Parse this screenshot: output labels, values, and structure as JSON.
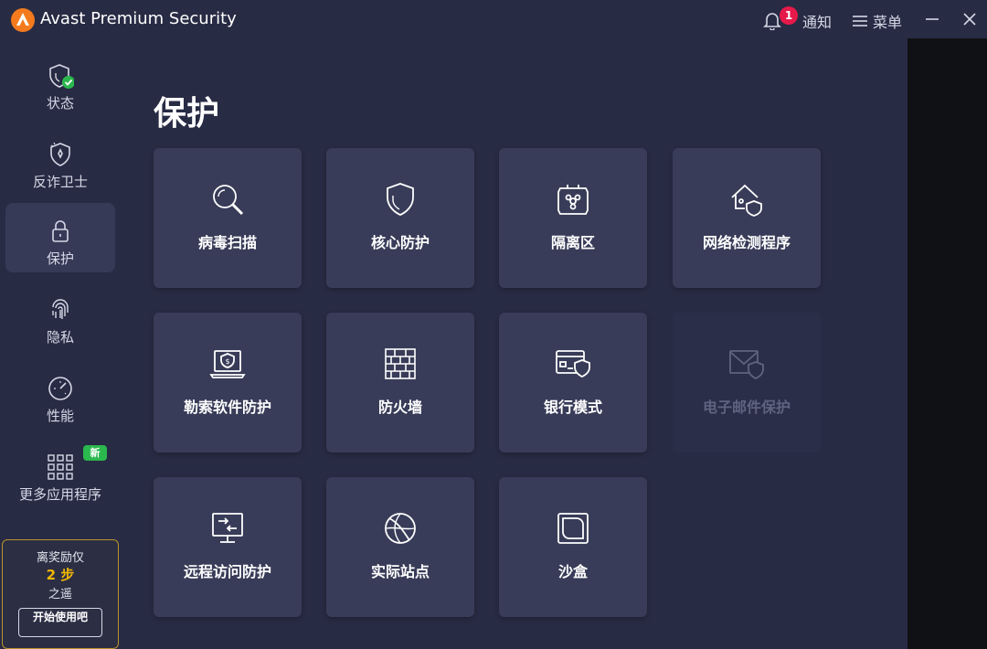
{
  "app": {
    "title": "Avast Premium Security"
  },
  "titlebar": {
    "notification_count": "1",
    "notification_label": "通知",
    "menu_label": "菜单"
  },
  "sidebar": {
    "items": [
      {
        "label": "状态",
        "icon": "shield-check-icon",
        "active": false
      },
      {
        "label": "反诈卫士",
        "icon": "shield-star-icon",
        "active": false
      },
      {
        "label": "保护",
        "icon": "lock-icon",
        "active": true
      },
      {
        "label": "隐私",
        "icon": "fingerprint-icon",
        "active": false
      },
      {
        "label": "性能",
        "icon": "speedometer-icon",
        "active": false
      },
      {
        "label": "更多应用程序",
        "icon": "apps-grid-icon",
        "active": false,
        "badge": "新"
      }
    ]
  },
  "reward": {
    "line1": "离奖励仅",
    "steps": "2 步",
    "line3": "之遥",
    "button_label": "开始使用吧"
  },
  "main": {
    "title": "保护",
    "tiles": [
      {
        "label": "病毒扫描",
        "icon": "magnifier-icon",
        "enabled": true
      },
      {
        "label": "核心防护",
        "icon": "shield-icon",
        "enabled": true
      },
      {
        "label": "隔离区",
        "icon": "biohazard-box-icon",
        "enabled": true
      },
      {
        "label": "网络检测程序",
        "icon": "home-network-shield-icon",
        "enabled": true
      },
      {
        "label": "勒索软件防护",
        "icon": "laptop-dollar-shield-icon",
        "enabled": true
      },
      {
        "label": "防火墙",
        "icon": "brick-wall-icon",
        "enabled": true
      },
      {
        "label": "银行模式",
        "icon": "card-shield-icon",
        "enabled": true
      },
      {
        "label": "电子邮件保护",
        "icon": "mail-shield-icon",
        "enabled": false
      },
      {
        "label": "远程访问防护",
        "icon": "remote-monitor-icon",
        "enabled": true
      },
      {
        "label": "实际站点",
        "icon": "globe-icon",
        "enabled": true
      },
      {
        "label": "沙盒",
        "icon": "sandbox-icon",
        "enabled": true
      }
    ]
  },
  "colors": {
    "background": "#282b44",
    "tile": "#383c58",
    "accent_orange": "#f37b1d",
    "badge_red": "#e5194a",
    "new_green": "#2bb84e",
    "reward_gold": "#f2b705"
  }
}
